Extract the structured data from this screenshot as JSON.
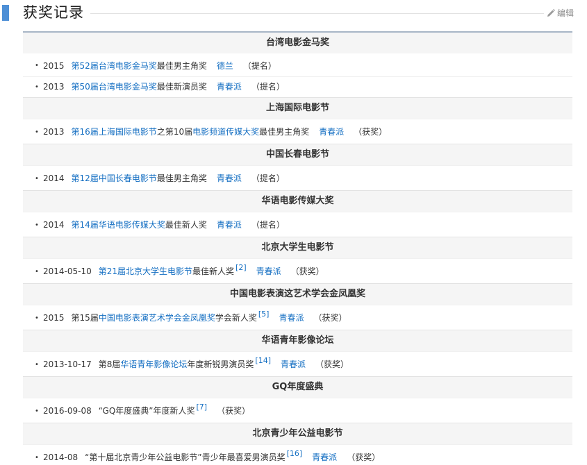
{
  "header": {
    "title": "获奖记录",
    "edit_label": "编辑"
  },
  "groups": [
    {
      "title": "台湾电影金马奖",
      "rows": [
        {
          "year": "2015",
          "pre": "",
          "link": "第52届台湾电影金马奖",
          "mid": "",
          "link2": "",
          "post": "最佳男主角奖",
          "sup": "",
          "work": "德兰",
          "status": "（提名）"
        },
        {
          "year": "2013",
          "pre": "",
          "link": "第50届台湾电影金马奖",
          "mid": "",
          "link2": "",
          "post": "最佳新演员奖",
          "sup": "",
          "work": "青春派",
          "status": "（提名）"
        }
      ]
    },
    {
      "title": "上海国际电影节",
      "rows": [
        {
          "year": "2013",
          "pre": "",
          "link": "第16届上海国际电影节",
          "mid": "之第10届",
          "link2": "电影频道传媒大奖",
          "post": "最佳男主角奖",
          "sup": "",
          "work": "青春派",
          "status": "（获奖）"
        }
      ]
    },
    {
      "title": "中国长春电影节",
      "rows": [
        {
          "year": "2014",
          "pre": "",
          "link": "第12届中国长春电影节",
          "mid": "",
          "link2": "",
          "post": "最佳男主角奖",
          "sup": "",
          "work": "青春派",
          "status": "（提名）"
        }
      ]
    },
    {
      "title": "华语电影传媒大奖",
      "rows": [
        {
          "year": "2014",
          "pre": "",
          "link": "第14届华语电影传媒大奖",
          "mid": "",
          "link2": "",
          "post": "最佳新人奖",
          "sup": "",
          "work": "青春派",
          "status": "（提名）"
        }
      ]
    },
    {
      "title": "北京大学生电影节",
      "rows": [
        {
          "year": "2014-05-10",
          "pre": "",
          "link": "第21届北京大学生电影节",
          "mid": "",
          "link2": "",
          "post": "最佳新人奖",
          "sup": "[2]",
          "work": "青春派",
          "status": "（获奖）"
        }
      ]
    },
    {
      "title": "中国电影表演这艺术学会金凤凰奖",
      "rows": [
        {
          "year": "2015",
          "pre": "第15届",
          "link": "中国电影表演艺术学会金凤凰奖",
          "mid": "",
          "link2": "",
          "post": "学会新人奖",
          "sup": "[5]",
          "work": "青春派",
          "status": "（获奖）"
        }
      ]
    },
    {
      "title": "华语青年影像论坛",
      "rows": [
        {
          "year": "2013-10-17",
          "pre": "第8届",
          "link": "华语青年影像论坛",
          "mid": "",
          "link2": "",
          "post": "年度新锐男演员奖",
          "sup": "[14]",
          "work": "青春派",
          "status": "（获奖）"
        }
      ]
    },
    {
      "title": "GQ年度盛典",
      "rows": [
        {
          "year": "2016-09-08",
          "pre": "“GQ年度盛典”年度新人奖",
          "link": "",
          "mid": "",
          "link2": "",
          "post": "",
          "sup": "[7]",
          "work": "",
          "status": "（获奖）"
        }
      ]
    },
    {
      "title": "北京青少年公益电影节",
      "rows": [
        {
          "year": "2014-08",
          "pre": "“第十届北京青少年公益电影节”青少年最喜爱男演员奖",
          "link": "",
          "mid": "",
          "link2": "",
          "post": "",
          "sup": "[16]",
          "work": "青春派",
          "status": "（获奖）"
        }
      ]
    }
  ],
  "colors": {
    "accent_bar": "#4d8fd6",
    "link": "#136ec2",
    "group_header_bg": "#f5f5f5",
    "table_top_border": "#a7b6c6"
  },
  "icons": {
    "edit": "pencil-icon"
  }
}
